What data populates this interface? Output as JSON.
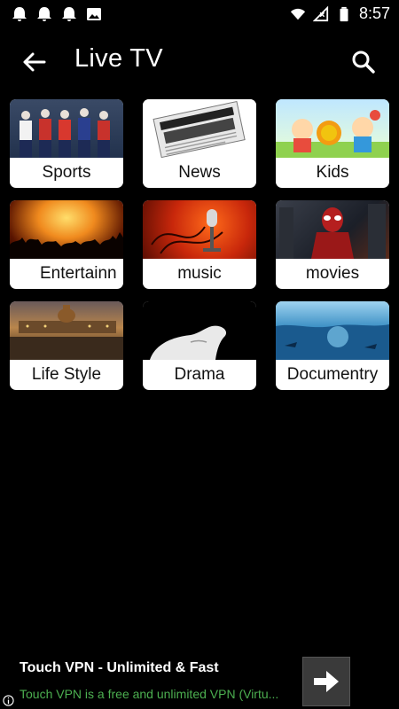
{
  "status_bar": {
    "time": "8:57",
    "left_icons": [
      "notification-bell-icon",
      "notification-bell-icon",
      "notification-bell-icon",
      "image-icon"
    ],
    "right_icons": [
      "wifi-icon",
      "signal-icon",
      "battery-icon"
    ]
  },
  "app_bar": {
    "title": "Live TV",
    "back_icon": "arrow-left-icon",
    "search_icon": "search-icon"
  },
  "categories": [
    {
      "label": "Sports"
    },
    {
      "label": "News"
    },
    {
      "label": "Kids"
    },
    {
      "label": "Entertainn"
    },
    {
      "label": "music"
    },
    {
      "label": "movies"
    },
    {
      "label": "Life Style"
    },
    {
      "label": "Drama"
    },
    {
      "label": "Documentry"
    }
  ],
  "ad": {
    "title": "Touch VPN - Unlimited & Fast",
    "description": "Touch VPN is a free and unlimited VPN (Virtu...",
    "button_icon": "arrow-right-icon",
    "info_icon": "info-icon",
    "description_color": "#4caf50"
  },
  "colors": {
    "background": "#000000",
    "tile_background": "#ffffff"
  }
}
